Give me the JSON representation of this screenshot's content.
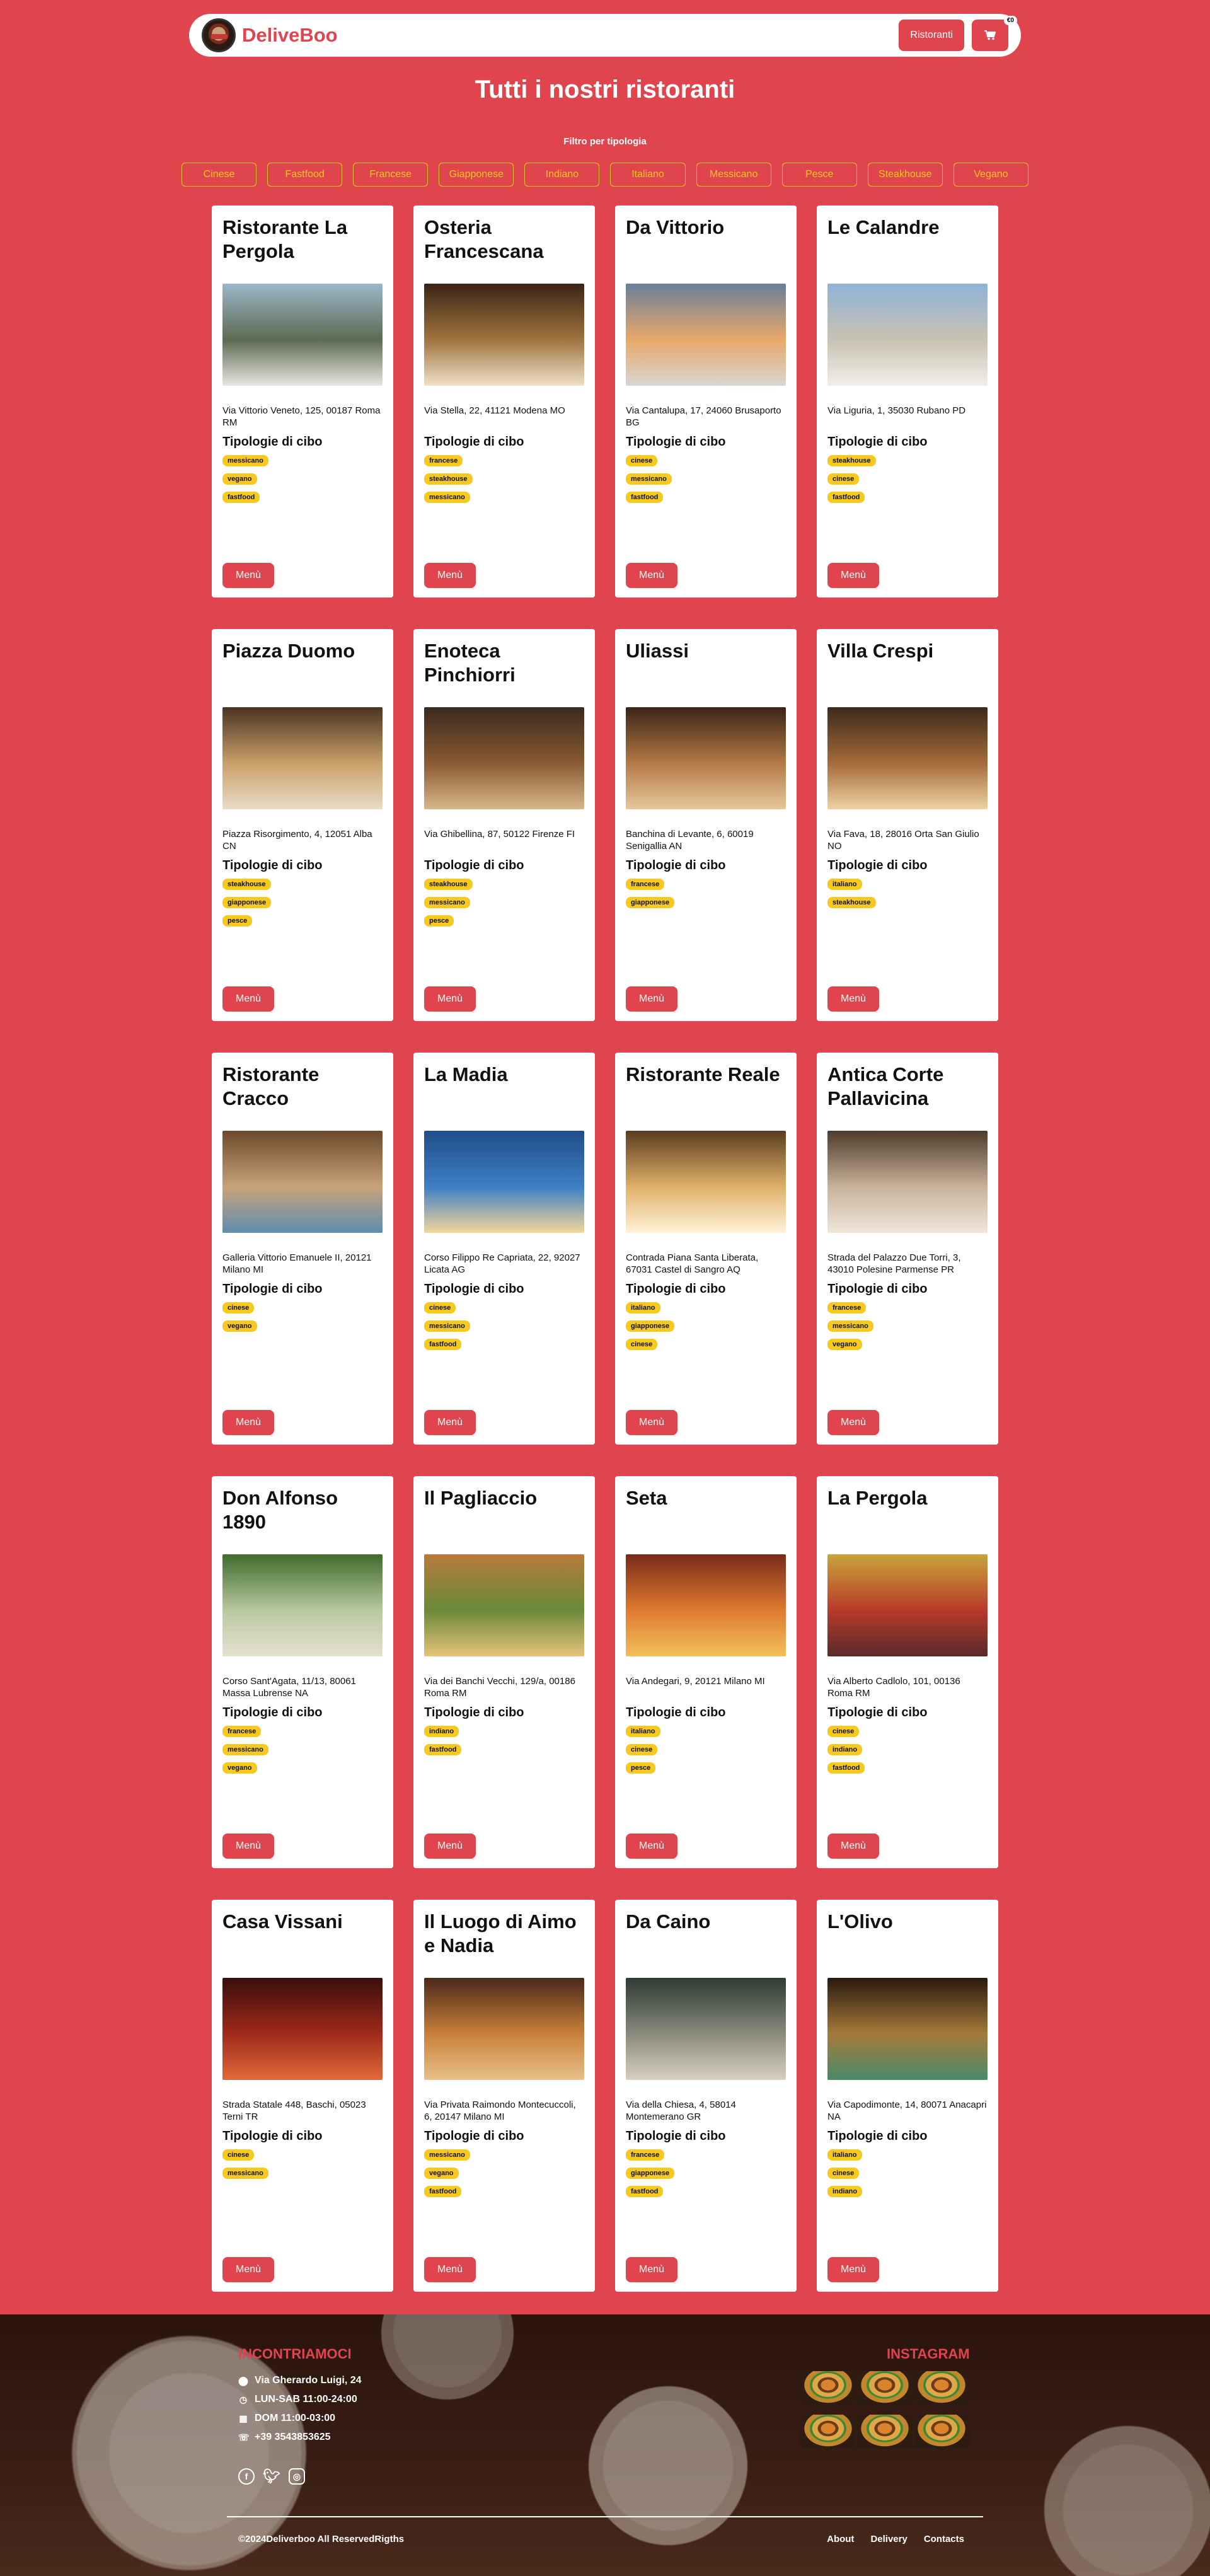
{
  "nav": {
    "brand": "DeliveBoo",
    "restaurants_label": "Ristoranti",
    "cart_badge": "€0"
  },
  "page_title": "Tutti i nostri ristoranti",
  "filter_label": "Filtro per tipologia",
  "filters": [
    "Cinese",
    "Fastfood",
    "Francese",
    "Giapponese",
    "Indiano",
    "Italiano",
    "Messicano",
    "Pesce",
    "Steakhouse",
    "Vegano"
  ],
  "section_label": "Tipologie di cibo",
  "menu_label": "Menù",
  "restaurants": [
    {
      "name": "Ristorante La Pergola",
      "address": "Via Vittorio Veneto, 125, 00187 Roma RM",
      "tags": [
        "messicano",
        "vegano",
        "fastfood"
      ]
    },
    {
      "name": "Osteria Francescana",
      "address": "Via Stella, 22, 41121 Modena MO",
      "tags": [
        "francese",
        "steakhouse",
        "messicano"
      ]
    },
    {
      "name": "Da Vittorio",
      "address": "Via Cantalupa, 17, 24060 Brusaporto BG",
      "tags": [
        "cinese",
        "messicano",
        "fastfood"
      ]
    },
    {
      "name": "Le Calandre",
      "address": "Via Liguria, 1, 35030 Rubano PD",
      "tags": [
        "steakhouse",
        "cinese",
        "fastfood"
      ]
    },
    {
      "name": "Piazza Duomo",
      "address": "Piazza Risorgimento, 4, 12051 Alba CN",
      "tags": [
        "steakhouse",
        "giapponese",
        "pesce"
      ]
    },
    {
      "name": "Enoteca Pinchiorri",
      "address": "Via Ghibellina, 87, 50122 Firenze FI",
      "tags": [
        "steakhouse",
        "messicano",
        "pesce"
      ]
    },
    {
      "name": "Uliassi",
      "address": "Banchina di Levante, 6, 60019 Senigallia AN",
      "tags": [
        "francese",
        "giapponese"
      ]
    },
    {
      "name": "Villa Crespi",
      "address": "Via Fava, 18, 28016 Orta San Giulio NO",
      "tags": [
        "italiano",
        "steakhouse"
      ]
    },
    {
      "name": "Ristorante Cracco",
      "address": "Galleria Vittorio Emanuele II, 20121 Milano MI",
      "tags": [
        "cinese",
        "vegano"
      ]
    },
    {
      "name": "La Madia",
      "address": "Corso Filippo Re Capriata, 22, 92027 Licata AG",
      "tags": [
        "cinese",
        "messicano",
        "fastfood"
      ]
    },
    {
      "name": "Ristorante Reale",
      "address": "Contrada Piana Santa Liberata, 67031 Castel di Sangro AQ",
      "tags": [
        "italiano",
        "giapponese",
        "cinese"
      ]
    },
    {
      "name": "Antica Corte Pallavicina",
      "address": "Strada del Palazzo Due Torri, 3, 43010 Polesine Parmense PR",
      "tags": [
        "francese",
        "messicano",
        "vegano"
      ]
    },
    {
      "name": "Don Alfonso 1890",
      "address": "Corso Sant'Agata, 11/13, 80061 Massa Lubrense NA",
      "tags": [
        "francese",
        "messicano",
        "vegano"
      ]
    },
    {
      "name": "Il Pagliaccio",
      "address": "Via dei Banchi Vecchi, 129/a, 00186 Roma RM",
      "tags": [
        "indiano",
        "fastfood"
      ]
    },
    {
      "name": "Seta",
      "address": "Via Andegari, 9, 20121 Milano MI",
      "tags": [
        "italiano",
        "cinese",
        "pesce"
      ]
    },
    {
      "name": "La Pergola",
      "address": "Via Alberto Cadlolo, 101, 00136 Roma RM",
      "tags": [
        "cinese",
        "indiano",
        "fastfood"
      ]
    },
    {
      "name": "Casa Vissani",
      "address": "Strada Statale 448, Baschi, 05023 Terni TR",
      "tags": [
        "cinese",
        "messicano"
      ]
    },
    {
      "name": "Il Luogo di Aimo e Nadia",
      "address": "Via Privata Raimondo Montecuccoli, 6, 20147 Milano MI",
      "tags": [
        "messicano",
        "vegano",
        "fastfood"
      ]
    },
    {
      "name": "Da Caino",
      "address": "Via della Chiesa, 4, 58014 Montemerano GR",
      "tags": [
        "francese",
        "giapponese",
        "fastfood"
      ]
    },
    {
      "name": "L'Olivo",
      "address": "Via Capodimonte, 14, 80071 Anacapri NA",
      "tags": [
        "italiano",
        "cinese",
        "indiano"
      ]
    }
  ],
  "footer": {
    "contact_title": "INCONTRIAMOCI",
    "address": "Via Gherardo Luigi, 24",
    "hours_weekday": "LUN-SAB 11:00-24:00",
    "hours_sunday": "DOM 11:00-03:00",
    "phone": "+39 3543853625",
    "instagram_title": "INSTAGRAM",
    "copyright": "©2024Deliverboo All ReservedRigths",
    "links": [
      "About",
      "Delivery",
      "Contacts"
    ]
  },
  "colors": {
    "brand": "#e0444d",
    "tag": "#f7c81e",
    "card": "#ffffff"
  }
}
